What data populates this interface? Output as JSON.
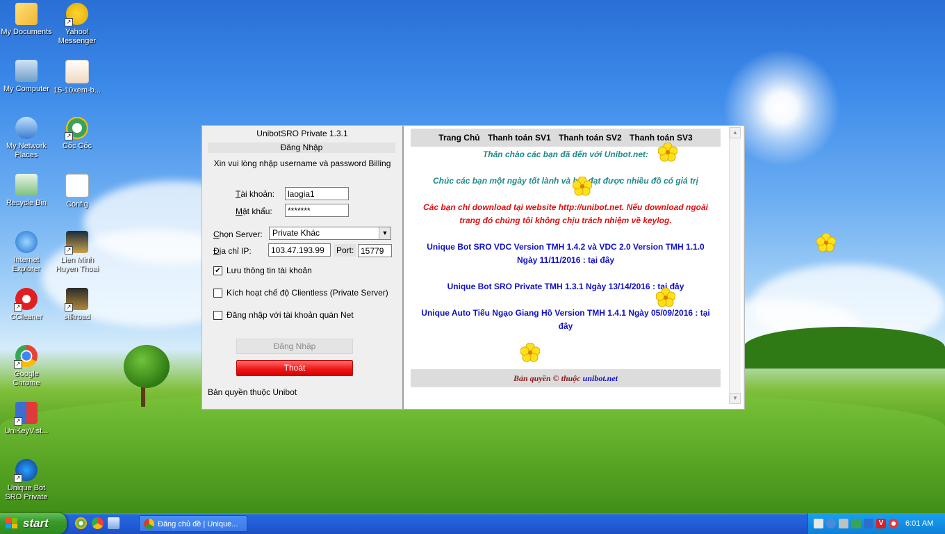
{
  "desktop": {
    "icons": [
      {
        "id": "my-documents",
        "label": "My Documents",
        "shortcut": false
      },
      {
        "id": "yahoo-messenger",
        "label": "Yahoo! Messenger",
        "shortcut": true
      },
      {
        "id": "my-computer",
        "label": "My Computer",
        "shortcut": false
      },
      {
        "id": "file-15-10xem",
        "label": "15-10xem-b...",
        "shortcut": false
      },
      {
        "id": "my-network-places",
        "label": "My Network Places",
        "shortcut": false
      },
      {
        "id": "coc-coc",
        "label": "Cốc Cốc",
        "shortcut": true
      },
      {
        "id": "recycle-bin",
        "label": "Recycle Bin",
        "shortcut": false
      },
      {
        "id": "config",
        "label": "Config",
        "shortcut": false
      },
      {
        "id": "internet-explorer",
        "label": "Internet Explorer",
        "shortcut": false
      },
      {
        "id": "lien-minh",
        "label": "Lien Minh Huyen Thoai",
        "shortcut": true
      },
      {
        "id": "ccleaner",
        "label": "CCleaner",
        "shortcut": true
      },
      {
        "id": "silkroad",
        "label": "silkroad",
        "shortcut": true
      },
      {
        "id": "google-chrome",
        "label": "Google Chrome",
        "shortcut": true
      },
      {
        "id": "unikey",
        "label": "UniKeyVist...",
        "shortcut": true
      },
      {
        "id": "unique-bot",
        "label": "Unique Bot SRO Private",
        "shortcut": true
      }
    ]
  },
  "app": {
    "title": "UnibotSRO Private 1.3.1",
    "section": "Đăng Nhập",
    "prompt": "Xin vui lòng nhập username và password Billing",
    "account_label_u": "T",
    "account_label_rest": "ài khoản:",
    "account_value": "laogia1",
    "password_label_u": "M",
    "password_label_rest": "ật khẩu:",
    "password_value": "*******",
    "server_label_u": "C",
    "server_label_rest": "họn Server:",
    "server_value": "Private Khác",
    "ip_label_u": "Đ",
    "ip_label_rest": "ịa chỉ IP:",
    "ip_value": "103.47.193.99",
    "port_label": "Port:",
    "port_value": "15779",
    "checkboxes": [
      {
        "label": "Lưu thông tin tài khoản",
        "checked": true
      },
      {
        "label": "Kích hoạt chế độ Clientless (Private Server)",
        "checked": false
      },
      {
        "label": "Đăng nhập với tài khoản quán Net",
        "checked": false
      }
    ],
    "login_button": "Đăng Nhập",
    "exit_button": "Thoát",
    "copyright": "Bản quyền thuộc Unibot"
  },
  "web": {
    "nav": [
      "Trang Chủ",
      "Thanh toán SV1",
      "Thanh toán SV2",
      "Thanh toán SV3"
    ],
    "welcome": "Thân chào các bạn đã đến với Unibot.net:",
    "wish": "Chúc các bạn một ngày tốt lành và bot đạt được nhiều đồ có giá trị",
    "warning": "Các bạn chỉ download tại website http://unibot.net. Nếu download ngoài trang đó chúng tôi không chịu trách nhiệm về keylog.",
    "download1": "Unique Bot SRO VDC Version TMH 1.4.2 và VDC 2.0 Version TMH 1.1.0 Ngày 11/11/2016 : tại đây",
    "download2": "Unique Bot SRO Private TMH 1.3.1 Ngày 13/14/2016 : tại đây",
    "download3": "Unique Auto Tiếu Ngạo Giang Hồ Version TMH 1.4.1 Ngày 05/09/2016 : tại đây",
    "footer_prefix": "Bản quyền © thuộc",
    "footer_link": "unibot.net"
  },
  "taskbar": {
    "start_label": "start",
    "task_label": "Đăng chủ đề | Unique...",
    "clock": "6:01 AM"
  }
}
